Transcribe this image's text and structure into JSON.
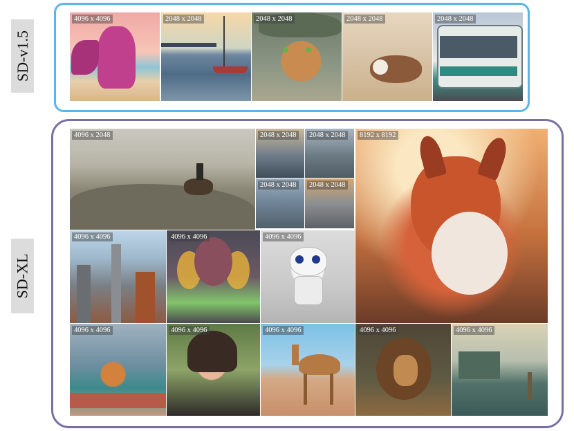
{
  "labels": {
    "sd15": "SD-v1.5",
    "sdxl": "SD-XL"
  },
  "sd15_tiles": [
    {
      "id": "dragon",
      "res": "4096 x 4096"
    },
    {
      "id": "harbor",
      "res": "2048 x 2048"
    },
    {
      "id": "cat",
      "res": "2048 x 2048"
    },
    {
      "id": "dogs",
      "res": "2048 x 2048"
    },
    {
      "id": "bus",
      "res": "2048 x 2048"
    }
  ],
  "sdxl_tiles": [
    {
      "id": "horse",
      "res": "4096 x 2048"
    },
    {
      "id": "mini1",
      "res": "2048 x 2048"
    },
    {
      "id": "mini2",
      "res": "2048 x 2048"
    },
    {
      "id": "mini3",
      "res": "2048 x 2048"
    },
    {
      "id": "mini4",
      "res": "2048 x 2048"
    },
    {
      "id": "fox",
      "res": "8192 x 8192"
    },
    {
      "id": "city",
      "res": "4096 x 4096"
    },
    {
      "id": "fairy",
      "res": "4096 x 4096"
    },
    {
      "id": "robot",
      "res": "4096 x 4096"
    },
    {
      "id": "corgi",
      "res": "4096 x 4096"
    },
    {
      "id": "girl",
      "res": "4096 x 4096"
    },
    {
      "id": "camel",
      "res": "4096 x 4096"
    },
    {
      "id": "lion",
      "res": "4096 x 4096"
    },
    {
      "id": "ruins",
      "res": "4096 x 4096"
    }
  ],
  "colors": {
    "sd15_border": "#5ab6ea",
    "sdxl_border": "#7a6ea3",
    "label_bg": "#dcdcdc"
  }
}
